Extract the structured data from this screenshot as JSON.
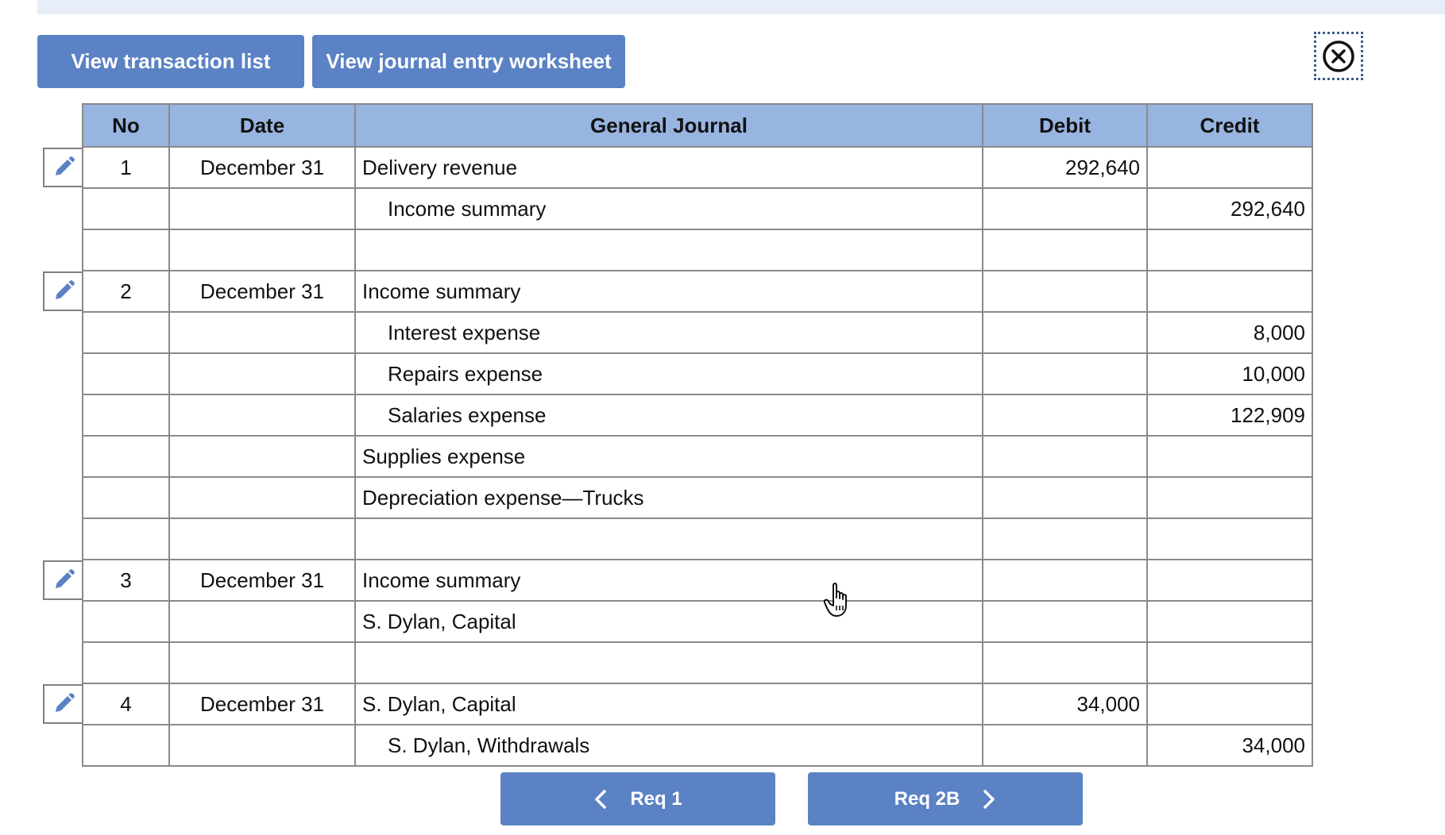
{
  "header": {
    "view_transaction_list": "View transaction list",
    "view_journal_entry_worksheet": "View journal entry worksheet"
  },
  "table": {
    "columns": {
      "no": "No",
      "date": "Date",
      "account": "General Journal",
      "debit": "Debit",
      "credit": "Credit"
    },
    "rows": [
      {
        "no": "1",
        "date": "December 31",
        "account": "Delivery revenue",
        "indent": false,
        "debit": "292,640",
        "credit": "",
        "edit": true
      },
      {
        "no": "",
        "date": "",
        "account": "Income summary",
        "indent": true,
        "debit": "",
        "credit": "292,640",
        "edit": false
      },
      {
        "no": "",
        "date": "",
        "account": "",
        "indent": false,
        "debit": "",
        "credit": "",
        "edit": false
      },
      {
        "no": "2",
        "date": "December 31",
        "account": "Income summary",
        "indent": false,
        "debit": "",
        "credit": "",
        "edit": true
      },
      {
        "no": "",
        "date": "",
        "account": "Interest expense",
        "indent": true,
        "debit": "",
        "credit": "8,000",
        "edit": false
      },
      {
        "no": "",
        "date": "",
        "account": "Repairs expense",
        "indent": true,
        "debit": "",
        "credit": "10,000",
        "edit": false
      },
      {
        "no": "",
        "date": "",
        "account": "Salaries expense",
        "indent": true,
        "debit": "",
        "credit": "122,909",
        "edit": false
      },
      {
        "no": "",
        "date": "",
        "account": "Supplies expense",
        "indent": false,
        "debit": "",
        "credit": "",
        "edit": false
      },
      {
        "no": "",
        "date": "",
        "account": "Depreciation expense—Trucks",
        "indent": false,
        "debit": "",
        "credit": "",
        "edit": false
      },
      {
        "no": "",
        "date": "",
        "account": "",
        "indent": false,
        "debit": "",
        "credit": "",
        "edit": false
      },
      {
        "no": "3",
        "date": "December 31",
        "account": "Income summary",
        "indent": false,
        "debit": "",
        "credit": "",
        "edit": true
      },
      {
        "no": "",
        "date": "",
        "account": "S. Dylan, Capital",
        "indent": false,
        "debit": "",
        "credit": "",
        "edit": false
      },
      {
        "no": "",
        "date": "",
        "account": "",
        "indent": false,
        "debit": "",
        "credit": "",
        "edit": false
      },
      {
        "no": "4",
        "date": "December 31",
        "account": "S. Dylan, Capital",
        "indent": false,
        "debit": "34,000",
        "credit": "",
        "edit": true
      },
      {
        "no": "",
        "date": "",
        "account": "S. Dylan, Withdrawals",
        "indent": true,
        "debit": "",
        "credit": "34,000",
        "edit": false
      }
    ]
  },
  "nav": {
    "prev_label": "Req 1",
    "next_label": "Req 2B"
  },
  "icons": {
    "close": "close-circle-icon",
    "edit": "pencil-icon",
    "prev": "chevron-left-icon",
    "next": "chevron-right-icon",
    "cursor": "hand-cursor-icon"
  },
  "colors": {
    "button": "#5b82c4",
    "header_row": "#98b4e0",
    "top_band": "#e7eef7",
    "grid": "#8a8a8a"
  }
}
